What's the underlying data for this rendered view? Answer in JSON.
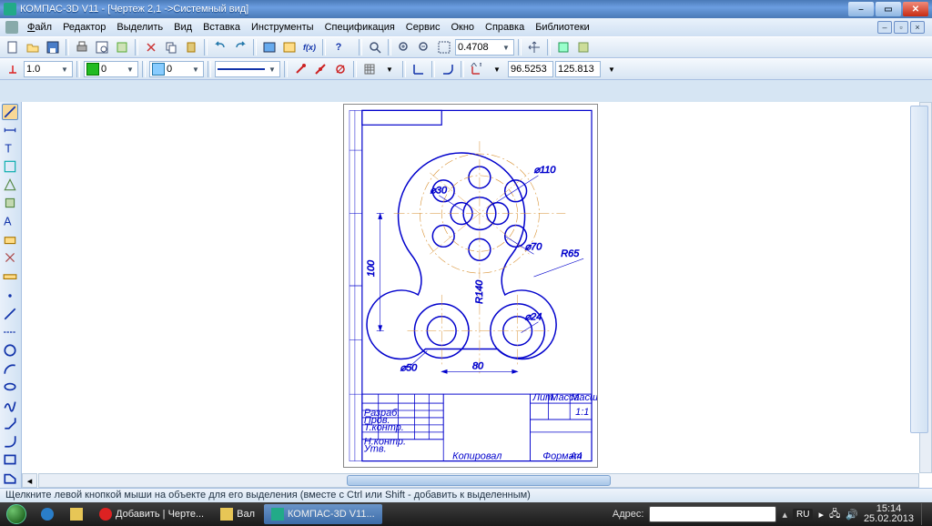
{
  "title": "КОМПАС-3D V11 - [Чертеж 2,1 ->Системный вид]",
  "menu": [
    "Файл",
    "Редактор",
    "Выделить",
    "Вид",
    "Вставка",
    "Инструменты",
    "Спецификация",
    "Сервис",
    "Окно",
    "Справка",
    "Библиотеки"
  ],
  "toolbar2": {
    "zoom_value": "0.4708"
  },
  "toolbar3": {
    "step": "1.0",
    "style": "0",
    "layer": "0",
    "coord_x": "96.5253",
    "coord_y": "125.813"
  },
  "status": "Щелкните левой кнопкой мыши на объекте для его выделения (вместе с Ctrl или Shift - добавить к выделенным)",
  "drawing": {
    "dims": {
      "d1": "⌀30",
      "d2": "⌀110",
      "d3": "⌀70",
      "d4": "R65",
      "d5": "⌀24",
      "d6": "⌀50",
      "d7": "R140",
      "d8": "80",
      "d9": "100",
      "title_scale": "1:1",
      "title_fmt": "A4"
    },
    "title_block": {
      "copied": "Копировал",
      "format": "Формат",
      "own1": "Разраб.",
      "own2": "Пров.",
      "own3": "Т.контр.",
      "own4": "Н.контр.",
      "own5": "Утв.",
      "lit": "Лит.",
      "mass": "Масса",
      "sc": "Масштаб"
    }
  },
  "taskbar": {
    "items": [
      "Добавить | Черте...",
      "Вал",
      "КОМПАС-3D V11..."
    ],
    "addr_label": "Адрес:",
    "lang": "RU",
    "time": "15:14",
    "date": "25.02.2013"
  }
}
